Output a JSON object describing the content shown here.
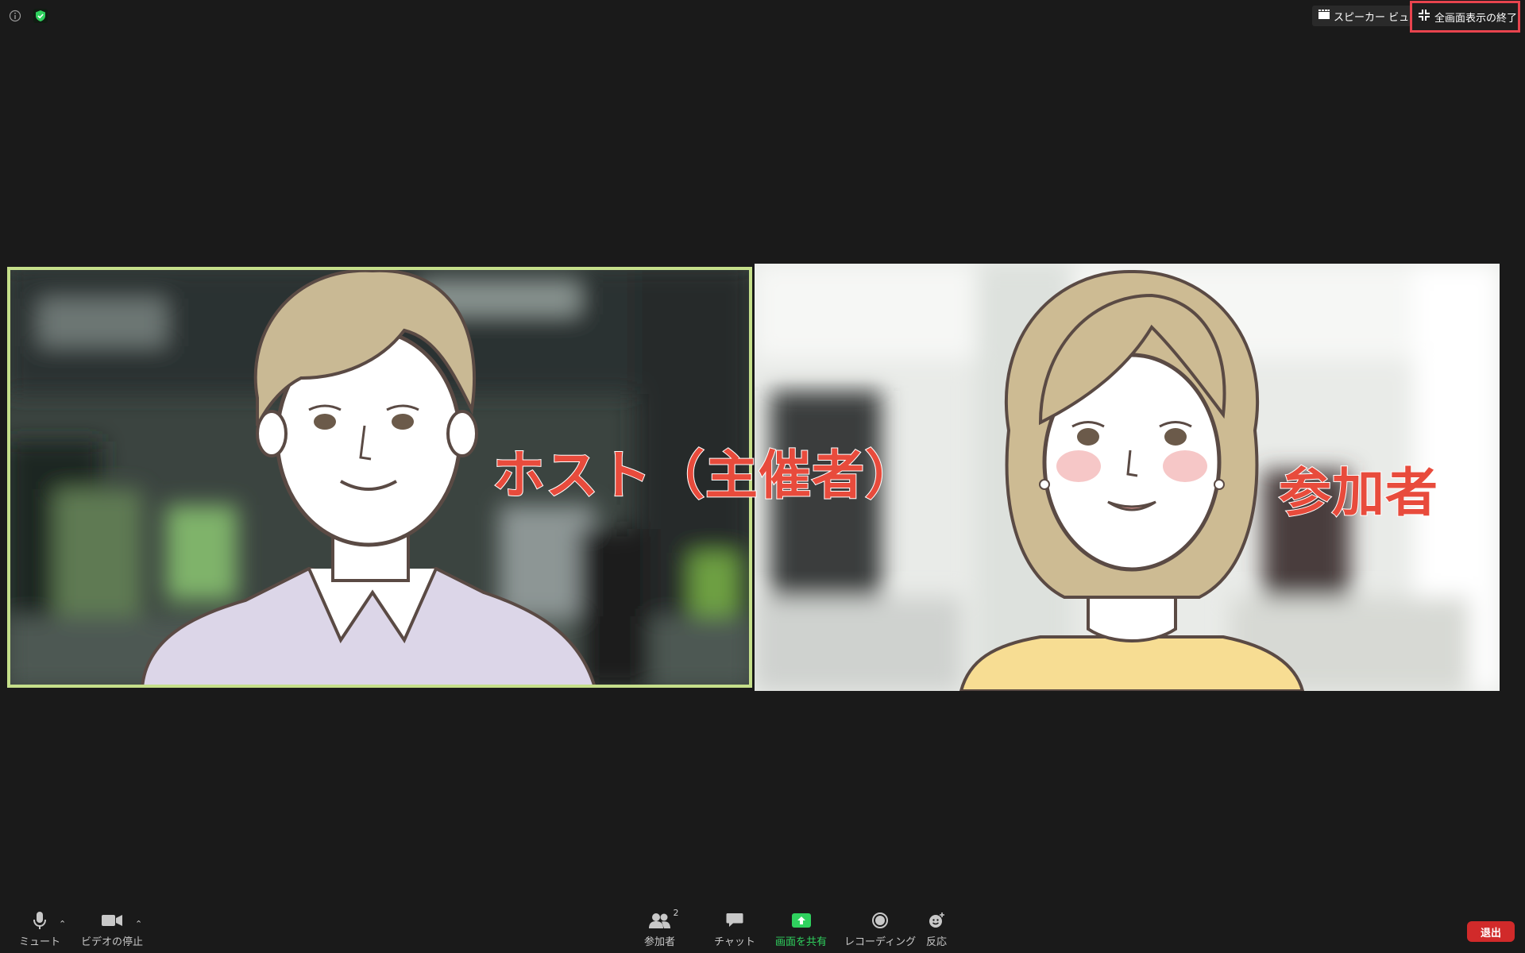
{
  "top_bar": {
    "speaker_view_label": "スピーカー ビュー",
    "exit_fullscreen_label": "全画面表示の終了"
  },
  "video": {
    "host_label": "ホスト（主催者）",
    "participant_label": "参加者"
  },
  "toolbar": {
    "mute_label": "ミュート",
    "video_stop_label": "ビデオの停止",
    "participants_label": "参加者",
    "participants_count": "2",
    "chat_label": "チャット",
    "share_screen_label": "画面を共有",
    "recording_label": "レコーディング",
    "reactions_label": "反応",
    "leave_label": "退出"
  },
  "colors": {
    "active_speaker_border": "#c5df8a",
    "label_red": "#e84b3c",
    "share_green": "#2fd15e",
    "leave_red": "#d12a2a",
    "exit_highlight": "#e8444e"
  },
  "icons": [
    "info-icon",
    "shield-icon",
    "grid-icon",
    "exit-fullscreen-icon",
    "microphone-icon",
    "video-camera-icon",
    "participants-icon",
    "chat-icon",
    "share-screen-icon",
    "record-icon",
    "reaction-icon"
  ]
}
